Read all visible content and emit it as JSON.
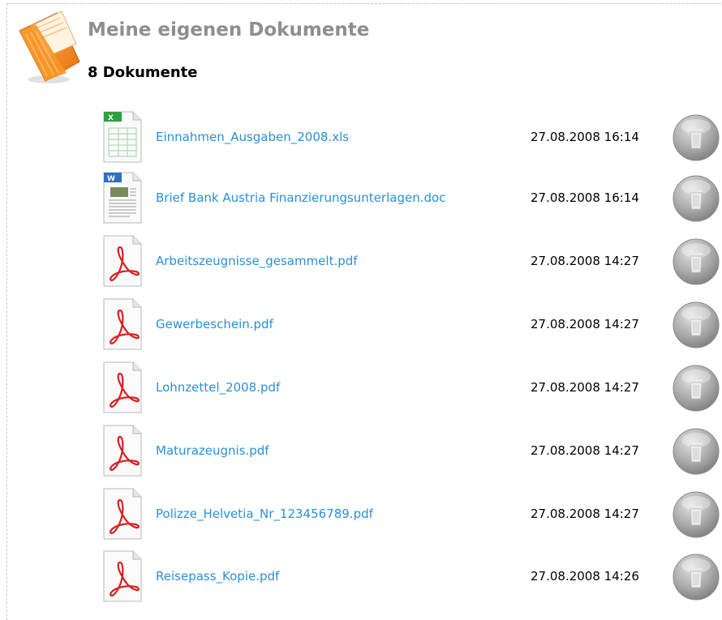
{
  "header": {
    "title": "Meine eigenen Dokumente",
    "count_label": "8 Dokumente"
  },
  "documents": [
    {
      "name": "Einnahmen_Ausgaben_2008.xls",
      "date": "27.08.2008 16:14",
      "type": "xls"
    },
    {
      "name": "Brief Bank Austria Finanzierungsunterlagen.doc",
      "date": "27.08.2008 16:14",
      "type": "doc"
    },
    {
      "name": "Arbeitszeugnisse_gesammelt.pdf",
      "date": "27.08.2008 14:27",
      "type": "pdf"
    },
    {
      "name": "Gewerbeschein.pdf",
      "date": "27.08.2008 14:27",
      "type": "pdf"
    },
    {
      "name": "Lohnzettel_2008.pdf",
      "date": "27.08.2008 14:27",
      "type": "pdf"
    },
    {
      "name": "Maturazeugnis.pdf",
      "date": "27.08.2008 14:27",
      "type": "pdf"
    },
    {
      "name": "Polizze_Helvetia_Nr_123456789.pdf",
      "date": "27.08.2008 14:27",
      "type": "pdf"
    },
    {
      "name": "Reisepass_Kopie.pdf",
      "date": "27.08.2008 14:26",
      "type": "pdf"
    }
  ],
  "colors": {
    "link": "#2a8fd6",
    "title_gray": "#8e8e8e",
    "folder_orange": "#f08a1c",
    "pdf_red": "#d8201e",
    "xls_green": "#2e9e3e",
    "doc_blue": "#2f6fc0"
  },
  "icons": {
    "folder": "documents-folder-icon",
    "xls": "spreadsheet-file-icon",
    "doc": "word-document-icon",
    "pdf": "pdf-file-icon",
    "delete": "trash-icon"
  }
}
